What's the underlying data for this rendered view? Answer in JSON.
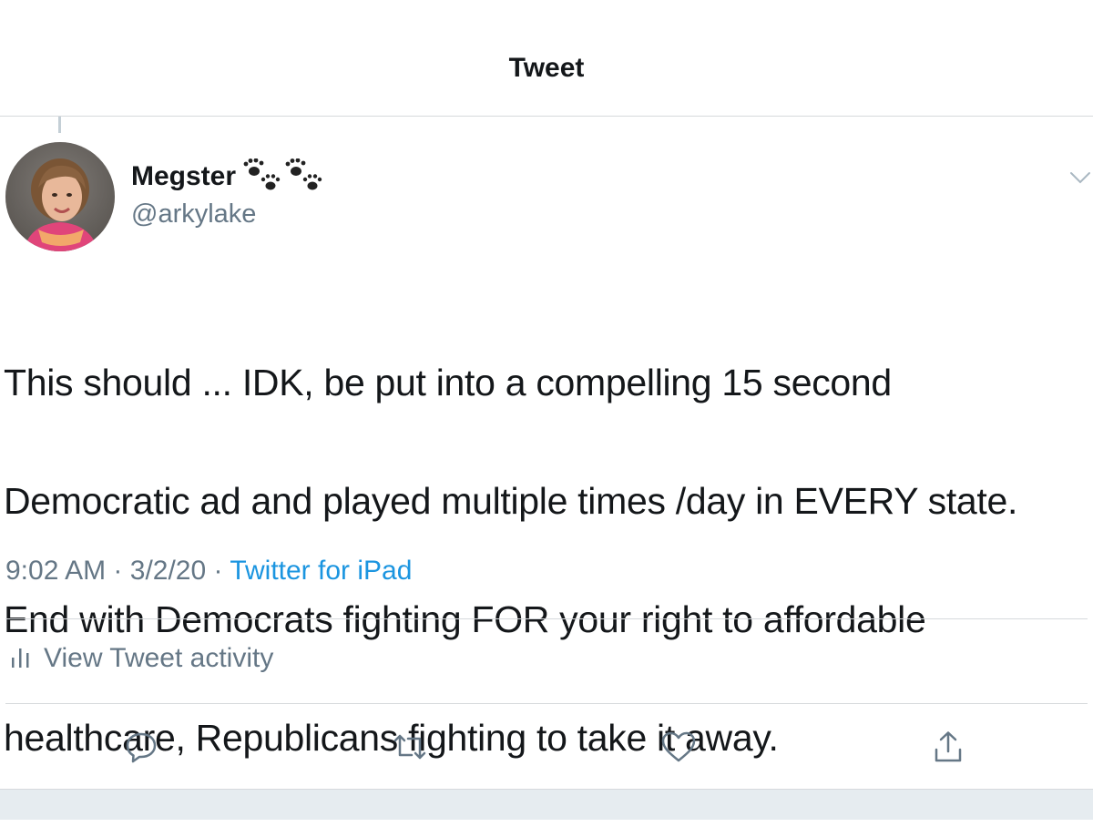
{
  "header": {
    "title": "Tweet"
  },
  "tweet": {
    "author": {
      "display_name": "Megster",
      "name_emoji": "paw-prints-icon",
      "handle": "@arkylake"
    },
    "text_lines": [
      "This should ... IDK, be put into a compelling 15 second",
      "Democratic ad and played multiple times /day in EVERY state.",
      "End with Democrats fighting FOR your right to affordable",
      "healthcare, Republicans fighting to take it away."
    ],
    "time": "9:02 AM",
    "date": "3/2/20",
    "separator": "·",
    "source": "Twitter for iPad"
  },
  "activity": {
    "label": "View Tweet activity",
    "icon": "bar-chart-icon"
  },
  "actions": [
    {
      "name": "reply",
      "icon": "reply-icon"
    },
    {
      "name": "retweet",
      "icon": "retweet-icon"
    },
    {
      "name": "like",
      "icon": "heart-icon"
    },
    {
      "name": "share",
      "icon": "share-icon"
    }
  ],
  "colors": {
    "text": "#14171a",
    "secondary": "#657786",
    "link": "#1b95e0",
    "divider": "#d6d9dc"
  }
}
